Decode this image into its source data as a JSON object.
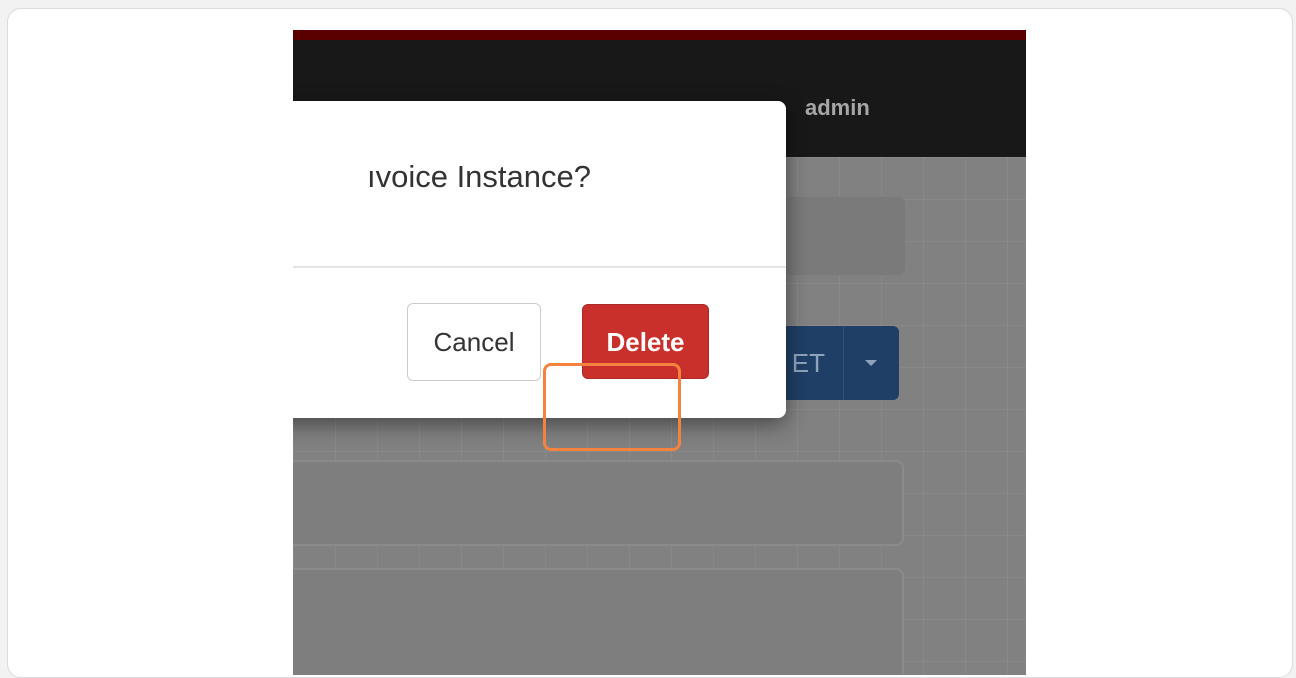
{
  "navbar": {
    "user_menu_label": "admin"
  },
  "background": {
    "split_button_label": "ET"
  },
  "dialog": {
    "title_fragment": "ıvoice Instance?",
    "cancel_label": "Cancel",
    "delete_label": "Delete"
  },
  "colors": {
    "navbar": "#181818",
    "top_strip": "#5a0000",
    "delete_button": "#c9302c",
    "highlight_outline": "#f5823e",
    "split_button": "#1f3f66"
  }
}
